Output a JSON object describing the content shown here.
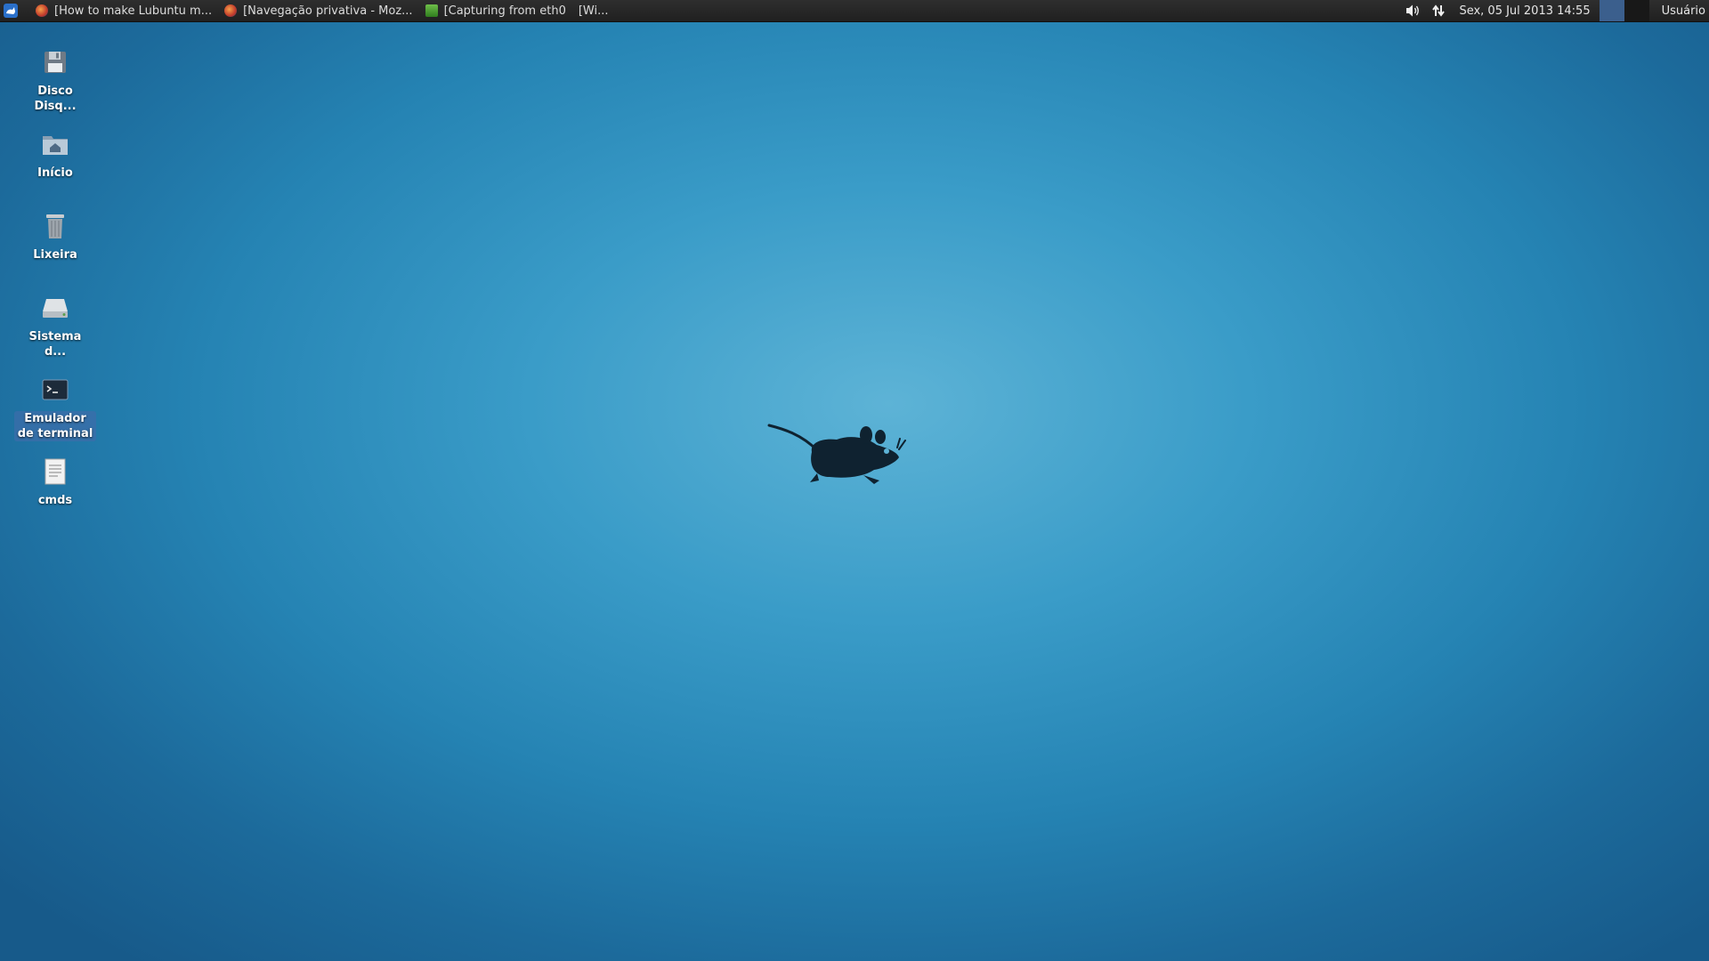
{
  "panel": {
    "tasks": [
      {
        "label": "[How to make Lubuntu m...",
        "icon": "firefox-icon"
      },
      {
        "label": "[Navegação privativa - Moz...",
        "icon": "firefox-icon"
      },
      {
        "label": "[Capturing from eth0",
        "icon": "wireshark-icon"
      },
      {
        "label": "[Wi...",
        "icon": ""
      }
    ],
    "clock": "Sex, 05 Jul 2013 14:55",
    "user": "Usuário"
  },
  "desktop": {
    "icons": [
      {
        "label": "Disco Disq...",
        "icon": "floppy-disk-icon"
      },
      {
        "label": "Início",
        "icon": "home-folder-icon"
      },
      {
        "label": "Lixeira",
        "icon": "trash-icon"
      },
      {
        "label": "Sistema d...",
        "icon": "filesystem-drive-icon"
      },
      {
        "label": "Emulador de terminal",
        "icon": "terminal-icon",
        "selected": true
      },
      {
        "label": "cmds",
        "icon": "text-file-icon"
      }
    ]
  },
  "colors": {
    "panel_bg": "#252525",
    "desktop_center": "#5db3d6",
    "desktop_edge": "#175a8a",
    "selection": "#3c6eaa"
  }
}
